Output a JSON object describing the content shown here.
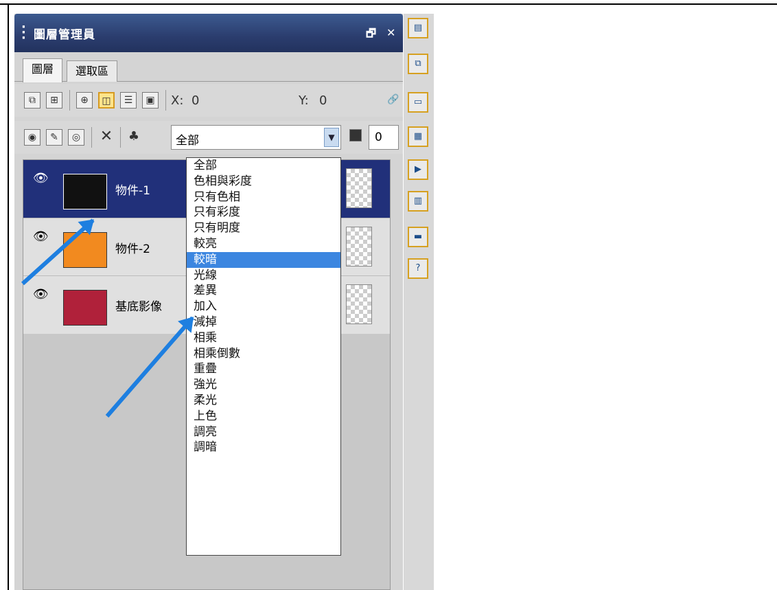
{
  "panel": {
    "title": "圖層管理員",
    "float_glyph": "🗗",
    "close_glyph": "✕",
    "tabs": [
      {
        "label": "圖層"
      },
      {
        "label": "選取區"
      }
    ]
  },
  "coords": {
    "x_label": "X:",
    "x_value": "0",
    "y_label": "Y:",
    "y_value": "0"
  },
  "blend": {
    "selected": "全部",
    "opacity": "0"
  },
  "layers": [
    {
      "name": "物件-1",
      "selected": true,
      "thumb_color": "#111111"
    },
    {
      "name": "物件-2",
      "selected": false,
      "thumb_color": "#f28a1f"
    },
    {
      "name": "基底影像",
      "selected": false,
      "thumb_color": "#b0213a"
    }
  ],
  "blend_options": [
    "全部",
    "色相與彩度",
    "只有色相",
    "只有彩度",
    "只有明度",
    "較亮",
    "較暗",
    "光線",
    "差異",
    "加入",
    "減掉",
    "相乘",
    "相乘倒數",
    "重疊",
    "強光",
    "柔光",
    "上色",
    "調亮",
    "調暗"
  ],
  "highlighted_option": "較暗",
  "icons": {
    "toolbar1": [
      "new-layer-icon",
      "new-object-layer-icon",
      "zoom-layer-icon",
      "move-layer-icon",
      "properties-icon",
      "thumbnail-icon",
      "link-icon"
    ],
    "toolbar2": [
      "visible-icon",
      "paint-icon",
      "lock-icon",
      "delete-icon",
      "blend-icon",
      "opacity-icon"
    ],
    "dock": [
      "image-icon",
      "copy-icon",
      "display-icon",
      "palette-icon",
      "play-icon",
      "browser-icon",
      "picture-icon",
      "help-icon"
    ]
  },
  "colors": {
    "accent_blue": "#21307a",
    "highlight": "#3c86e0",
    "arrow": "#1e7fe0",
    "dock_border": "#d6a020"
  }
}
